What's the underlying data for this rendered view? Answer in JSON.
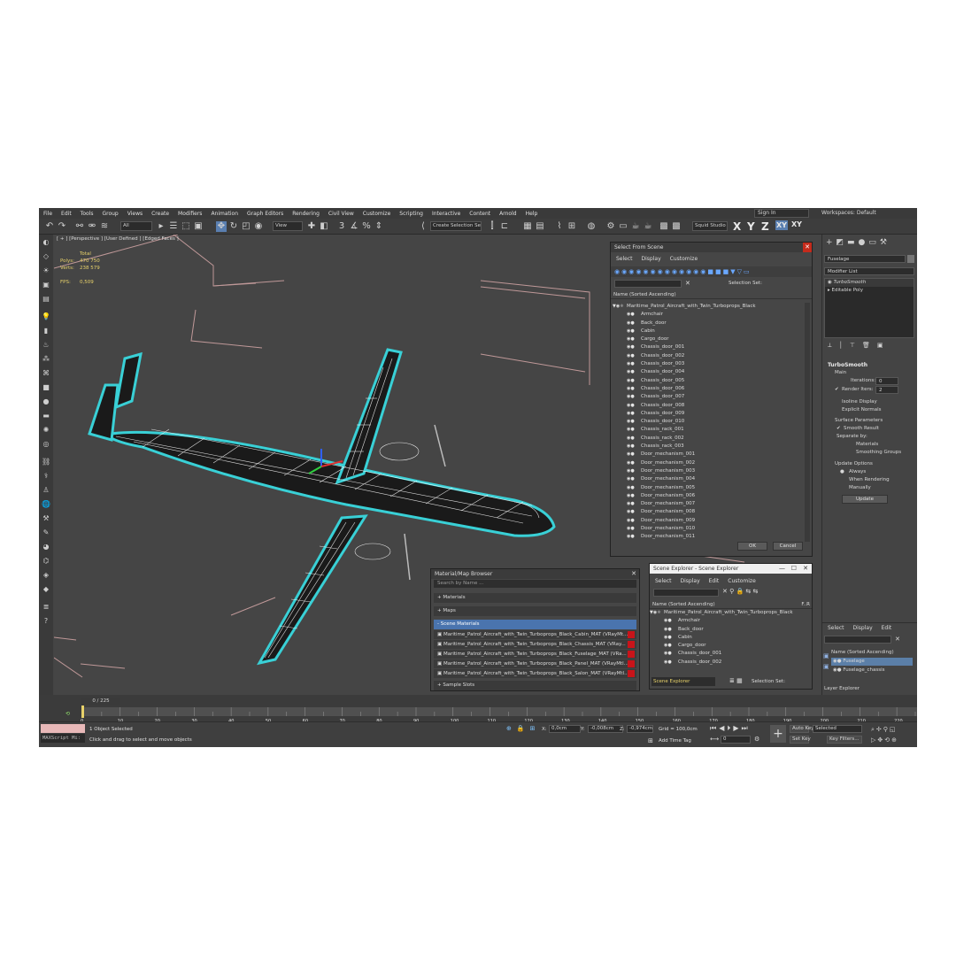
{
  "menu": [
    "File",
    "Edit",
    "Tools",
    "Group",
    "Views",
    "Create",
    "Modifiers",
    "Animation",
    "Graph Editors",
    "Rendering",
    "Civil View",
    "Customize",
    "Scripting",
    "Interactive",
    "Content",
    "Arnold",
    "Help"
  ],
  "signin": "Sign In",
  "workspaces": "Workspaces: Default",
  "toolbar": {
    "filter": "All",
    "ref_coord": "View",
    "selection_set": "Create Selection Se",
    "project": "Squid Studio v",
    "axes": [
      "X",
      "Y",
      "Z",
      "XY",
      "XY"
    ]
  },
  "viewport": {
    "label": "[ + ] [Perspective ] [User Defined ] [Edged Faces ]",
    "stats": {
      "header": "Total",
      "polys_label": "Polys:",
      "polys": "470 750",
      "verts_label": "Verts:",
      "verts": "238 579",
      "fps_label": "FPS:",
      "fps": "0,509"
    }
  },
  "select_dialog": {
    "title": "Select From Scene",
    "menu": [
      "Select",
      "Display",
      "Customize"
    ],
    "selection_set": "Selection Set:",
    "column": "Name (Sorted Ascending)",
    "root": "Maritime_Patrol_Aircraft_with_Twin_Turboprops_Black",
    "items": [
      "Armchair",
      "Back_door",
      "Cabin",
      "Cargo_door",
      "Chassis_door_001",
      "Chassis_door_002",
      "Chassis_door_003",
      "Chassis_door_004",
      "Chassis_door_005",
      "Chassis_door_006",
      "Chassis_door_007",
      "Chassis_door_008",
      "Chassis_door_009",
      "Chassis_door_010",
      "Chassis_rack_001",
      "Chassis_rack_002",
      "Chassis_rack_003",
      "Door_mechanism_001",
      "Door_mechanism_002",
      "Door_mechanism_003",
      "Door_mechanism_004",
      "Door_mechanism_005",
      "Door_mechanism_006",
      "Door_mechanism_007",
      "Door_mechanism_008",
      "Door_mechanism_009",
      "Door_mechanism_010",
      "Door_mechanism_011"
    ],
    "ok": "OK",
    "cancel": "Cancel"
  },
  "material_browser": {
    "title": "Material/Map Browser",
    "search": "Search by Name ...",
    "groups": [
      "+ Materials",
      "+ Maps",
      "- Scene Materials"
    ],
    "materials": [
      "Maritime_Patrol_Aircraft_with_Twin_Turboprops_Black_Cabin_MAT (VRayMt...",
      "Maritime_Patrol_Aircraft_with_Twin_Turboprops_Black_Chassis_MAT (VRay...",
      "Maritime_Patrol_Aircraft_with_Twin_Turboprops_Black_Fuselage_MAT (VRa...",
      "Maritime_Patrol_Aircraft_with_Twin_Turboprops_Black_Panel_MAT (VRayMtl...",
      "Maritime_Patrol_Aircraft_with_Twin_Turboprops_Black_Salon_MAT (VRayMtl..."
    ],
    "sample_slots": "+ Sample Slots"
  },
  "scene_explorer": {
    "title": "Scene Explorer - Scene Explorer",
    "menu": [
      "Select",
      "Display",
      "Edit",
      "Customize"
    ],
    "column": "Name (Sorted Ascending)",
    "col_right": "F..R",
    "root": "Maritime_Patrol_Aircraft_with_Twin_Turboprops_Black",
    "items": [
      "Armchair",
      "Back_door",
      "Cabin",
      "Cargo_door",
      "Chassis_door_001",
      "Chassis_door_002"
    ],
    "footer": "Scene Explorer",
    "selection_set": "Selection Set:"
  },
  "command_panel": {
    "object_name": "Fuselage",
    "modifier_list": "Modifier List",
    "stack": [
      "TurboSmooth",
      "Editable Poly"
    ],
    "turbosmooth": {
      "title": "TurboSmooth",
      "main": "Main",
      "iterations_label": "Iterations:",
      "iterations": "0",
      "render_iters_label": "Render Iters:",
      "render_iters": "2",
      "isoline": "Isoline Display",
      "explicit": "Explicit Normals",
      "surface": "Surface Parameters",
      "smooth_result": "Smooth Result",
      "separate_by": "Separate by:",
      "materials": "Materials",
      "smoothing_groups": "Smoothing Groups",
      "update_options": "Update Options",
      "always": "Always",
      "when_rendering": "When Rendering",
      "manually": "Manually",
      "update_btn": "Update"
    }
  },
  "layer_explorer": {
    "menu": [
      "Select",
      "Display",
      "Edit"
    ],
    "column": "Name (Sorted Ascending)",
    "items": [
      "Fuselage",
      "Fuselage_chassis"
    ],
    "footer": "Layer Explorer"
  },
  "timeline": {
    "frame": "0 / 225",
    "ticks": [
      "0",
      "10",
      "20",
      "30",
      "40",
      "50",
      "60",
      "70",
      "80",
      "90",
      "100",
      "110",
      "120",
      "130",
      "140",
      "150",
      "160",
      "170",
      "180",
      "190",
      "200",
      "210",
      "220"
    ]
  },
  "status": {
    "maxscript": "MAXScript Mi:",
    "selected": "1 Object Selected",
    "hint": "Click and drag to select and move objects",
    "x_label": "X:",
    "x": "0,0cm",
    "y_label": "Y:",
    "y": "-0,008cm",
    "z_label": "Z:",
    "z": "-0,974cm",
    "grid": "Grid = 100,0cm",
    "add_time_tag": "Add Time Tag",
    "auto_key": "Auto Key",
    "selected_dd": "Selected",
    "set_key": "Set Key",
    "key_filters": "Key Filters...",
    "frame_field": "0"
  },
  "colors": {
    "wire": "#ffffff",
    "selection": "#39d0d6",
    "bg": "#444444",
    "accent": "#4a74ae"
  }
}
